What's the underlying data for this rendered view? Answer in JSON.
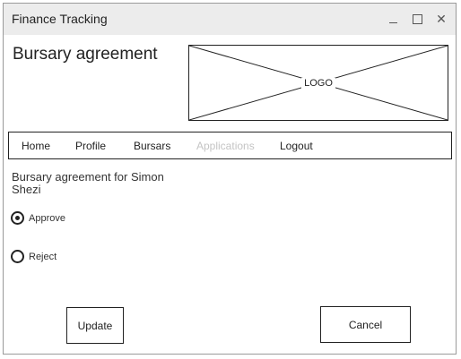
{
  "window": {
    "title": "Finance Tracking",
    "controls": {
      "minimize": "minimize-icon",
      "maximize": "maximize-icon",
      "close": "close-icon"
    }
  },
  "page": {
    "title": "Bursary agreement",
    "logo_label": "LOGO"
  },
  "nav": {
    "items": [
      {
        "label": "Home",
        "enabled": true
      },
      {
        "label": "Profile",
        "enabled": true
      },
      {
        "label": "Bursars",
        "enabled": true
      },
      {
        "label": "Applications",
        "enabled": false
      },
      {
        "label": "Logout",
        "enabled": true
      }
    ]
  },
  "agreement": {
    "text": "Bursary agreement for Simon Shezi",
    "options": [
      {
        "label": "Approve",
        "selected": true
      },
      {
        "label": "Reject",
        "selected": false
      }
    ]
  },
  "actions": {
    "update_label": "Update",
    "cancel_label": "Cancel"
  },
  "colors": {
    "titlebar": "#ececec",
    "border": "#222222",
    "disabled_text": "#c4c4c4"
  }
}
